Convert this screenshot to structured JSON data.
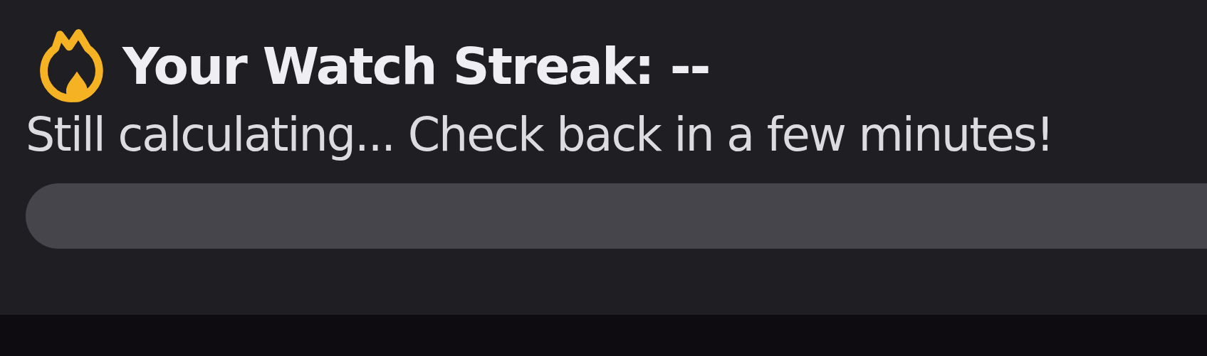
{
  "streak": {
    "title": "Your Watch Streak: --",
    "message": "Still calculating... Check back in a few minutes!",
    "progress": {
      "level": 0
    }
  }
}
